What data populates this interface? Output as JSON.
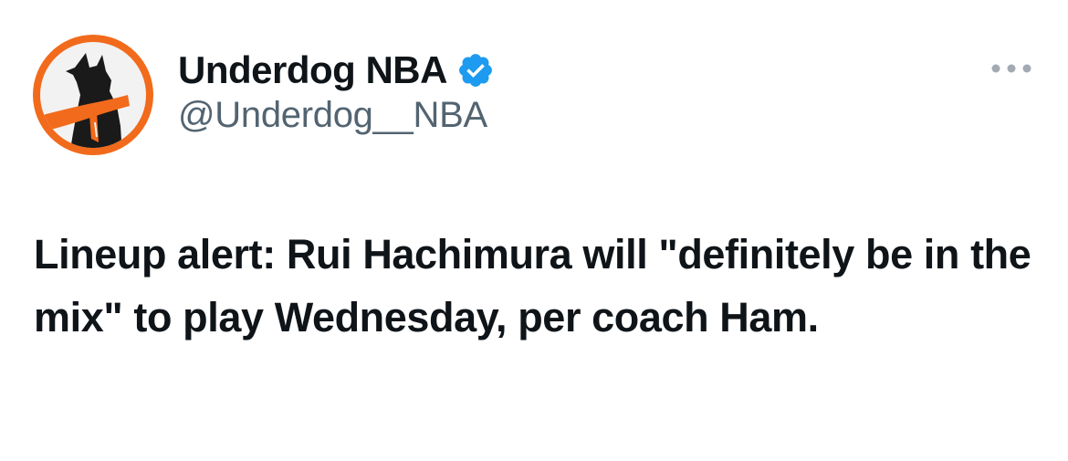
{
  "author": {
    "display_name": "Underdog NBA",
    "handle": "@Underdog__NBA",
    "verified": true,
    "avatar_icon": "underdog-logo-icon",
    "avatar_ring_color": "#f26a1b"
  },
  "tweet": {
    "text": "Lineup alert: Rui Hachimura will \"definitely be in the mix\" to play Wednesday, per coach Ham."
  },
  "menu": {
    "icon": "more-options-icon"
  },
  "colors": {
    "text_primary": "#0f1419",
    "text_secondary": "#536471",
    "verified_blue": "#1d9bf0",
    "menu_dots": "#a2abb3"
  }
}
